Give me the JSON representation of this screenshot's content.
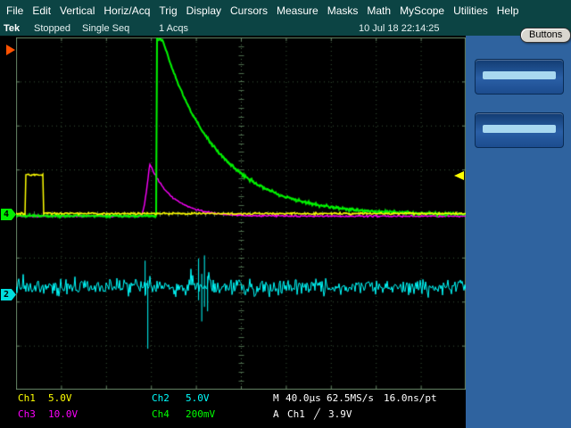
{
  "colors": {
    "header_bg": "#0c4444",
    "panel_bg": "#2f639f",
    "graticule_bg": "#000000",
    "grid": "#3a553a",
    "ch1": "#ffff00",
    "ch2": "#00ffff",
    "ch3": "#ff00ff",
    "ch4": "#00ff00",
    "trigger_marker_orange": "#ff5200"
  },
  "menu": {
    "items": [
      "File",
      "Edit",
      "Vertical",
      "Horiz/Acq",
      "Trig",
      "Display",
      "Cursors",
      "Measure",
      "Masks",
      "Math",
      "MyScope",
      "Utilities",
      "Help"
    ]
  },
  "status": {
    "brand": "Tek",
    "acq_state": "Stopped",
    "acq_mode": "Single Seq",
    "acq_count": "1 Acqs",
    "datetime": "10 Jul 18 22:14:25",
    "buttons_label": "Buttons"
  },
  "markers": {
    "ch4_label": "4",
    "ch2_label": "2"
  },
  "readouts": {
    "ch1_label": "Ch1",
    "ch1_scale": "5.0V",
    "ch2_label": "Ch2",
    "ch2_scale": "5.0V",
    "ch3_label": "Ch3",
    "ch3_scale": "10.0V",
    "ch4_label": "Ch4",
    "ch4_scale": "200mV",
    "horiz_prefix": "M",
    "horiz_timebase": "40.0µs",
    "horiz_samplerate": "62.5MS/s",
    "horiz_resolution": "16.0ns/pt",
    "trig_prefix": "A",
    "trig_source": "Ch1",
    "trig_slope": "╱",
    "trig_level": "3.9V"
  },
  "chart_data": {
    "type": "line",
    "title": "Oscilloscope single-sequence acquisition, four channels",
    "x_axis": {
      "divisions": 10,
      "scale": "40.0µs/div",
      "total_time": "400µs"
    },
    "y_axis": {
      "divisions": 8
    },
    "grid": true,
    "series": [
      {
        "name": "Ch3",
        "color": "#ff00ff",
        "scale": "10.0V/div",
        "shape": "spike-decay",
        "baseline_div": 4.06,
        "rise_start_x_div": 2.78,
        "peak_x_div": 2.97,
        "peak_y_div": 2.86,
        "decay_tau_div": 0.5,
        "description": "Sharp spike of about 1.2 div (~12V) at ~2.9 div after left edge, exponential decay back to baseline by ~4.4 div"
      },
      {
        "name": "Ch4",
        "color": "#00ff00",
        "scale": "200mV/div",
        "shape": "exp-decay",
        "baseline_div": 4.03,
        "rise_x_div": 3.13,
        "x0_div": 3.25,
        "amp_div": 4.0,
        "tau_div": 1.21,
        "clip_top_div": 0.05,
        "description": "Large exponential decay clipped at top of graticule, rising edge at ~3.1 div, settles to baseline near right edge"
      },
      {
        "name": "Ch1",
        "color": "#ffff00",
        "scale": "5.0V/div",
        "shape": "pulse",
        "baseline_div": 4.0,
        "pulse": {
          "x_start_div": 0.2,
          "x_end_div": 0.6,
          "top_y_div": 3.12
        },
        "description": "Flat baseline on center graticule line with one ~0.9 div (~4.4V) rectangular pulse near left edge"
      },
      {
        "name": "Ch2",
        "color": "#00ffff",
        "scale": "5.0V/div",
        "shape": "noise-band",
        "center_div": 5.67,
        "noise_amp_div": 0.28,
        "events": [
          {
            "x_div": 2.86,
            "up_div": 0.6,
            "down_div": 0.2
          },
          {
            "x_div": 2.92,
            "up_div": 0.15,
            "down_div": 1.4
          },
          {
            "x_div": 4.05,
            "up_div": 0.65,
            "down_div": 0.3
          },
          {
            "x_div": 4.12,
            "up_div": 0.3,
            "down_div": 0.78
          },
          {
            "x_div": 4.18,
            "up_div": 0.72,
            "down_div": 0.45
          },
          {
            "x_div": 4.25,
            "up_div": 0.25,
            "down_div": 0.55
          }
        ],
        "description": "Continuous broadband noise band with large burst excursions near the trigger event and just left of screen center"
      }
    ],
    "trigger": {
      "source": "Ch1",
      "slope": "rising",
      "level": "3.9V",
      "level_marker_y_div": 3.15
    }
  }
}
